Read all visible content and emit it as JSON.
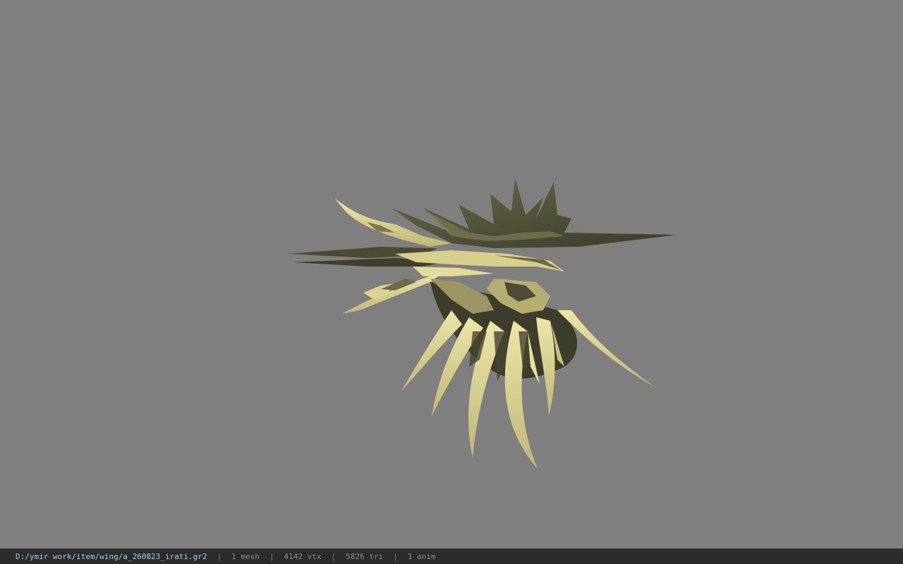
{
  "viewport": {
    "background": "#7f7f7f",
    "model_colors": {
      "light": "#e6dd9a",
      "mid": "#a9a36a",
      "dark": "#55553a",
      "shadow": "#2f3024"
    }
  },
  "status_bar": {
    "file_path": "D:/ymir work/item/wing/a_260823_irati.gr2",
    "separator": "|",
    "mesh_count": "1 mesh",
    "vertex_count": "4142 vtx",
    "triangle_count": "5826 tri",
    "anim_count": "1 anim",
    "path_color": "#9ecfe6"
  }
}
